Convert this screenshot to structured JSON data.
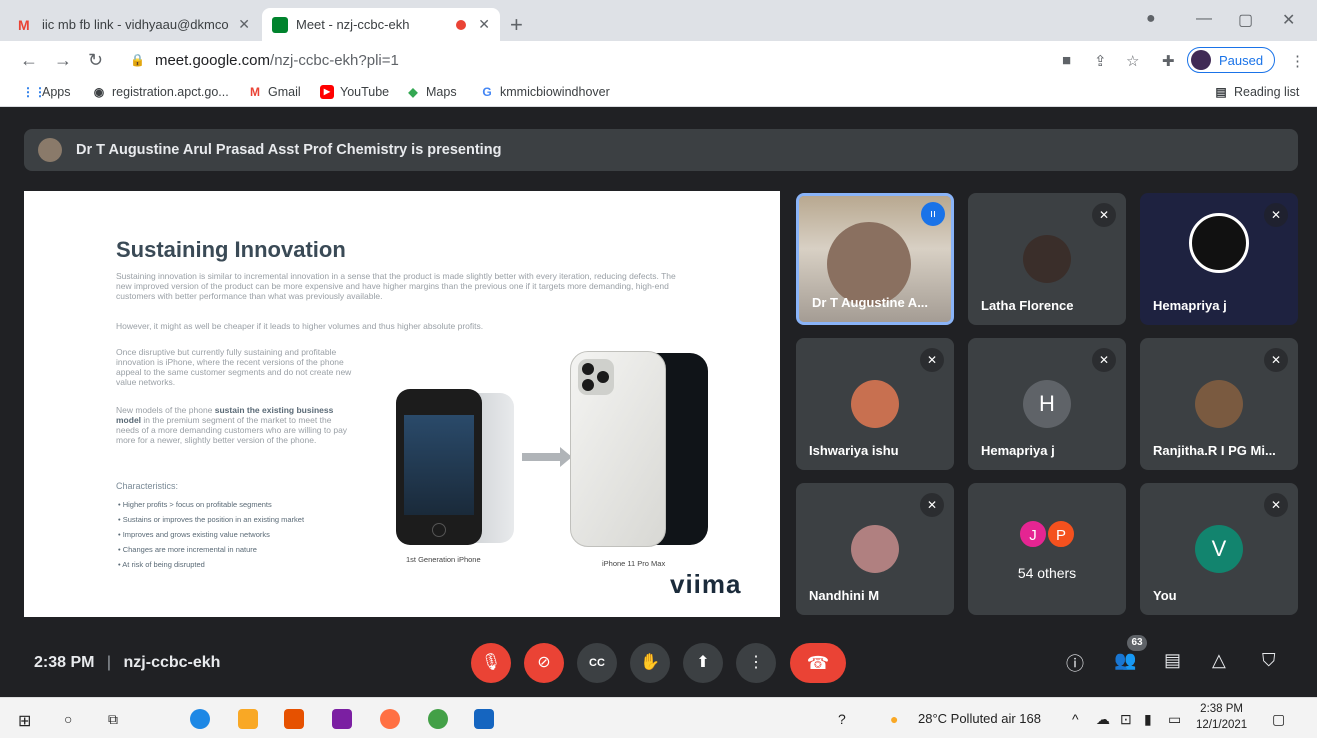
{
  "browser": {
    "tabs": [
      {
        "label": "iic mb fb link - vidhyaau@dkmco",
        "favicon": "gmail-icon"
      },
      {
        "label": "Meet - nzj-ccbc-ekh",
        "favicon": "meet-icon"
      }
    ],
    "url_host": "meet.google.com",
    "url_path": "/nzj-ccbc-ekh?pli=1",
    "profile_status": "Paused",
    "bookmarks": [
      "Apps",
      "registration.apct.go...",
      "Gmail",
      "YouTube",
      "Maps",
      "kmmicbiowindhover"
    ],
    "reading_list": "Reading list"
  },
  "meet": {
    "presenting_banner": "Dr T Augustine Arul Prasad Asst Prof Chemistry is presenting",
    "slide": {
      "title": "Sustaining Innovation",
      "para1": "Sustaining innovation is similar to incremental innovation in a sense that the product is made slightly better with every iteration, reducing defects. The new improved version of the product can be more expensive and have higher margins than the previous one if it targets more demanding, high-end customers with better performance than what was previously available.",
      "para1b": "However, it might as well be cheaper if it leads to higher volumes and thus higher absolute profits.",
      "para2": "Once disruptive but currently fully sustaining and profitable innovation is iPhone, where the recent versions of the phone appeal to the same customer segments and do not create new value networks.",
      "para3a": "New models of the phone ",
      "para3b": "sustain the existing business model",
      "para3c": " in the premium segment of the market to meet the needs of a more demanding customers who are willing to pay more for a newer, slightly better version of the phone.",
      "characteristics": "Characteristics:",
      "bullets": [
        "Higher profits > focus on profitable segments",
        "Sustains or improves the position in an existing market",
        "Improves and grows existing value networks",
        "Changes are more incremental in nature",
        "At risk of being disrupted"
      ],
      "caption_left": "1st Generation iPhone",
      "caption_right": "iPhone 11 Pro Max",
      "brand": "viima"
    },
    "participants": [
      {
        "name": "Dr T Augustine A...",
        "initial": "",
        "color": "#8a8079"
      },
      {
        "name": "Latha Florence",
        "initial": "",
        "color": "#3a2e2a"
      },
      {
        "name": "Hemapriya j",
        "initial": "",
        "color": "#111111"
      },
      {
        "name": "Ishwariya ishu",
        "initial": "",
        "color": "#c87050"
      },
      {
        "name": "Hemapriya j",
        "initial": "H",
        "color": "#5f6368"
      },
      {
        "name": "Ranjitha.R I PG Mi...",
        "initial": "",
        "color": "#7a5a40"
      },
      {
        "name": "Nandhini M",
        "initial": "",
        "color": "#b08080"
      },
      {
        "name": "54 others",
        "initial": "",
        "color": "#3c4043"
      },
      {
        "name": "You",
        "initial": "V",
        "color": "#12846e"
      }
    ],
    "others_avatars": [
      "J",
      "P"
    ],
    "time": "2:38 PM",
    "meeting_code": "nzj-ccbc-ekh",
    "people_count": "63"
  },
  "taskbar": {
    "weather": "28°C Polluted air 168",
    "time": "2:38 PM",
    "date": "12/1/2021"
  }
}
